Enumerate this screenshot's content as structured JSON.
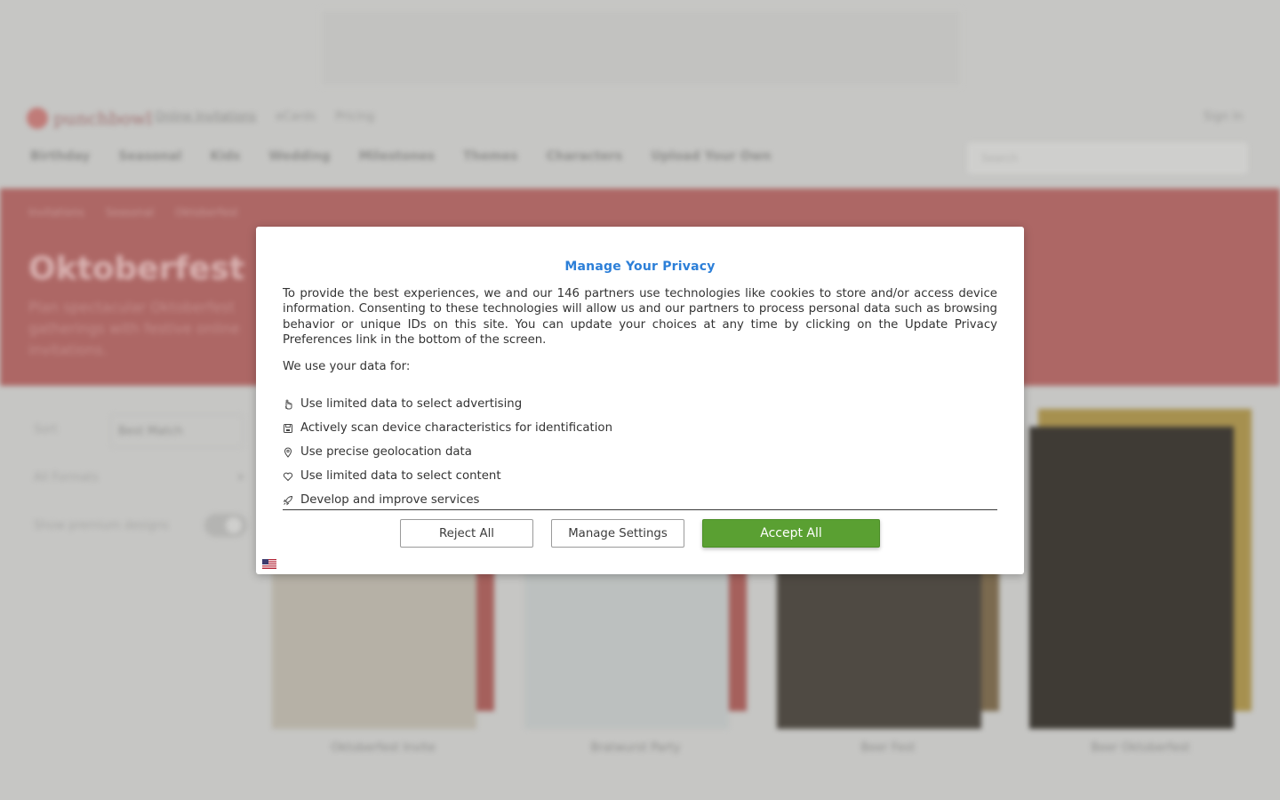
{
  "background": {
    "logo_text": "punchbowl",
    "top_links": [
      "Online Invitations",
      "eCards",
      "Pricing"
    ],
    "sign_in": "Sign In",
    "nav": [
      "Birthday",
      "Seasonal",
      "Kids",
      "Wedding",
      "Milestones",
      "Themes",
      "Characters",
      "Upload Your Own"
    ],
    "search_placeholder": "Search",
    "breadcrumb": [
      "Invitations",
      "Seasonal",
      "Oktoberfest"
    ],
    "hero_title": "Oktoberfest",
    "hero_subtitle": "Plan spectacular Oktoberfest gatherings with festive online invitations.",
    "sort_label": "Sort",
    "sort_value": "Best Match",
    "filter_label": "All Formats",
    "toggle_label": "Show premium designs",
    "cards": [
      {
        "name": "Oktoberfest Invite",
        "color": "#b6b1a6",
        "accent": "#a5605c"
      },
      {
        "name": "Bratwurst Party",
        "color": "#bcc0bf",
        "accent": "#a5605c"
      },
      {
        "name": "Beer Fest",
        "color": "#4f4a43",
        "accent": "#7b6a4f"
      },
      {
        "name": "Beer Oktoberfest",
        "color": "#3f3b35",
        "accent": "#a6904f"
      }
    ]
  },
  "dialog": {
    "title": "Manage Your Privacy",
    "body": "To provide the best experiences, we and our 146 partners use technologies like cookies to store and/or access device information. Consenting to these technologies will allow us and our partners to process personal data such as browsing behavior or unique IDs on this site. You can update your choices at any time by clicking on the Update Privacy Preferences link in the bottom of the screen.",
    "use_intro": "We use your data for:",
    "purposes": [
      {
        "label": "Use limited data to select advertising",
        "icon": "ad-hand-icon"
      },
      {
        "label": "Actively scan device characteristics for identification",
        "icon": "device-scan-icon"
      },
      {
        "label": "Use precise geolocation data",
        "icon": "location-pin-icon"
      },
      {
        "label": "Use limited data to select content",
        "icon": "heart-icon"
      },
      {
        "label": "Develop and improve services",
        "icon": "rocket-icon"
      }
    ],
    "buttons": {
      "reject": "Reject All",
      "manage": "Manage Settings",
      "accept": "Accept All"
    },
    "colors": {
      "title": "#2c7fd8",
      "accept_bg": "#5aa032"
    }
  }
}
